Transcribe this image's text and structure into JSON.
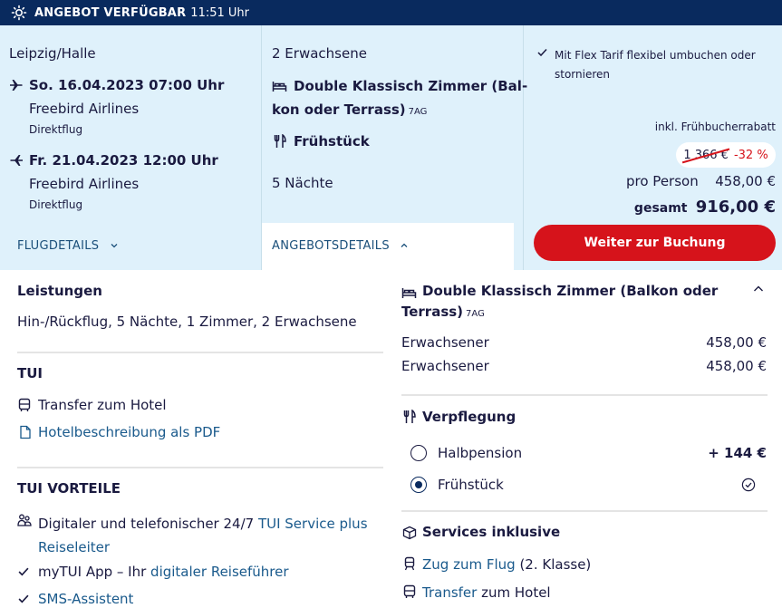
{
  "topbar": {
    "title": "ANGEBOT VERFÜGBAR",
    "time": "11:51 Uhr"
  },
  "flight": {
    "origin": "Leipzig/Halle",
    "outbound": {
      "date": "So. 16.04.2023 07:00 Uhr",
      "airline": "Freebird Airlines",
      "type": "Direktflug"
    },
    "inbound": {
      "date": "Fr. 21.04.2023 12:00 Uhr",
      "airline": "Freebird Airlines",
      "type": "Direktflug"
    },
    "details_label": "FLUGDETAILS"
  },
  "offer": {
    "travellers": "2 Erwachsene",
    "room": "Double Klassisch Zimmer (Bal-",
    "room_line2": "kon oder Terrass)",
    "room_tag": "7AG",
    "board": "Frühstück",
    "nights": "5 Nächte",
    "details_label": "ANGEBOTSDETAILS"
  },
  "pricing": {
    "flex_line1": "Mit Flex Tarif flexibel umbuchen oder",
    "flex_line2": "stornieren",
    "early_label": "inkl. Frühbucherrabatt",
    "old_price": "1 366 €",
    "discount": "-32 %",
    "per_person_label": "pro Person",
    "per_person_value": "458,00 €",
    "total_label": "gesamt",
    "total_value": "916,00 €",
    "book_label": "Weiter zur Buchung"
  },
  "details": {
    "services_title": "Leistungen",
    "services_text": "Hin-/Rückflug, 5 Nächte, 1 Zimmer, 2 Erwachsene",
    "tui_title": "TUI",
    "tui_items": [
      "Transfer zum Hotel",
      "Hotelbeschreibung als PDF"
    ],
    "advantages_title": "TUI VORTEILE",
    "adv1_prefix": "Digitaler und telefonischer 24/7",
    "adv1_link": "TUI Service plus",
    "adv1_link2": "Reiseleiter",
    "adv2_prefix": "myTUI App – Ihr",
    "adv2_link": "digitaler Reiseführer",
    "adv3_link": "SMS-Assistent",
    "room_title_line1": "Double Klassisch Zimmer (Balkon oder",
    "room_title_line2": "Terrass)",
    "room_tag": "7AG",
    "guests": [
      {
        "label": "Erwachsener",
        "price": "458,00 €"
      },
      {
        "label": "Erwachsener",
        "price": "458,00 €"
      }
    ],
    "board_title": "Verpflegung",
    "board_options": [
      {
        "label": "Halbpension",
        "price": "+ 144 €"
      },
      {
        "label": "Frühstück",
        "price": ""
      }
    ],
    "included_title": "Services inklusive",
    "inc1_link": "Zug zum Flug",
    "inc1_suffix": "(2. Klasse)",
    "inc2_link": "Transfer",
    "inc2_suffix": "zum Hotel"
  }
}
